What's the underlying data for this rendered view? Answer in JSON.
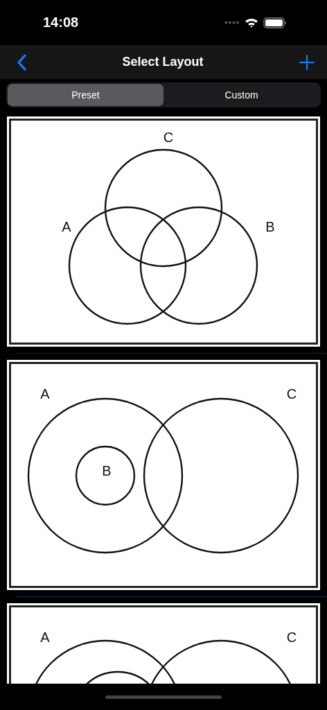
{
  "status_bar": {
    "time": "14:08"
  },
  "nav_bar": {
    "title": "Select Layout"
  },
  "segments": [
    {
      "label": "Preset",
      "selected": true
    },
    {
      "label": "Custom",
      "selected": false
    }
  ],
  "layouts": [
    {
      "kind": "triple",
      "labels": [
        "C",
        "A",
        "B"
      ]
    },
    {
      "kind": "nested",
      "labels": [
        "A",
        "C",
        "B"
      ]
    },
    {
      "kind": "nested-large",
      "labels": [
        "A",
        "C"
      ]
    }
  ]
}
